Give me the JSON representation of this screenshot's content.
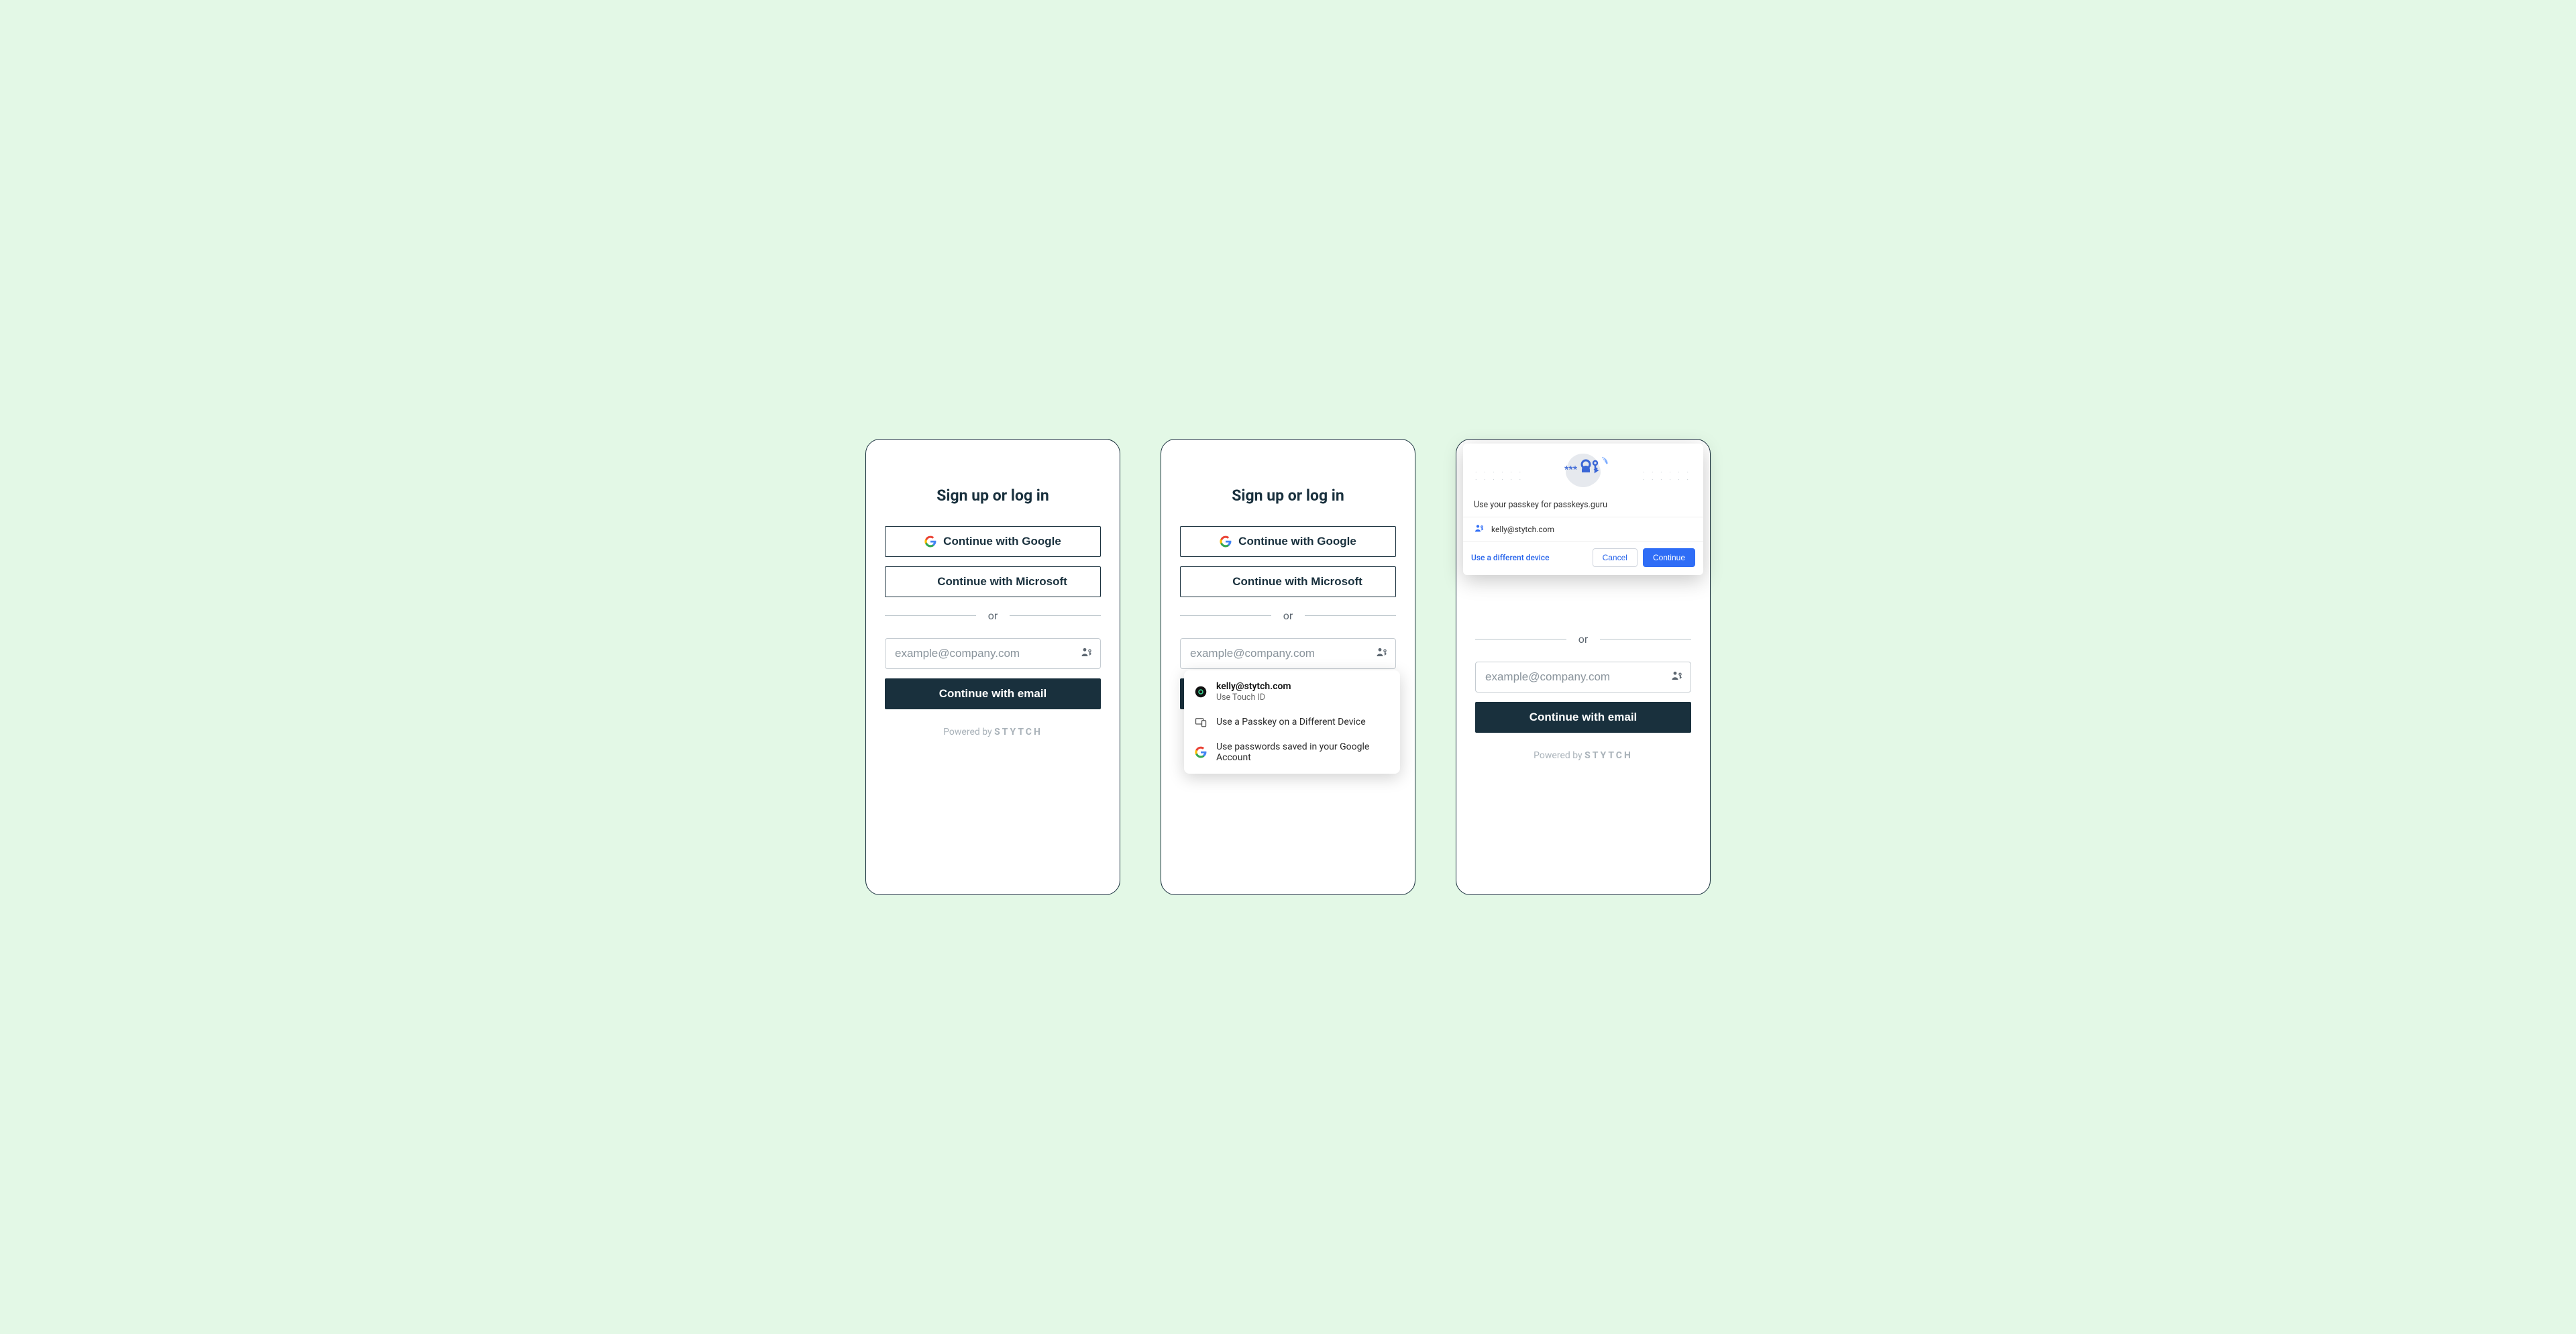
{
  "common": {
    "title": "Sign up or log in",
    "google_label": "Continue with Google",
    "microsoft_label": "Continue with Microsoft",
    "or": "or",
    "email_placeholder": "example@company.com",
    "continue_email": "Continue with email",
    "powered_prefix": "Powered by ",
    "powered_brand": "STYTCH"
  },
  "panel2": {
    "autofill": {
      "primary_email": "kelly@stytch.com",
      "primary_sub": "Use Touch ID",
      "alt_device": "Use a Passkey on a Different Device",
      "google_saved": "Use passwords saved in your Google Account"
    }
  },
  "panel3": {
    "prompt_text": "Use your passkey for passkeys.guru",
    "account_email": "kelly@stytch.com",
    "different_device": "Use a different device",
    "cancel": "Cancel",
    "continue": "Continue"
  }
}
